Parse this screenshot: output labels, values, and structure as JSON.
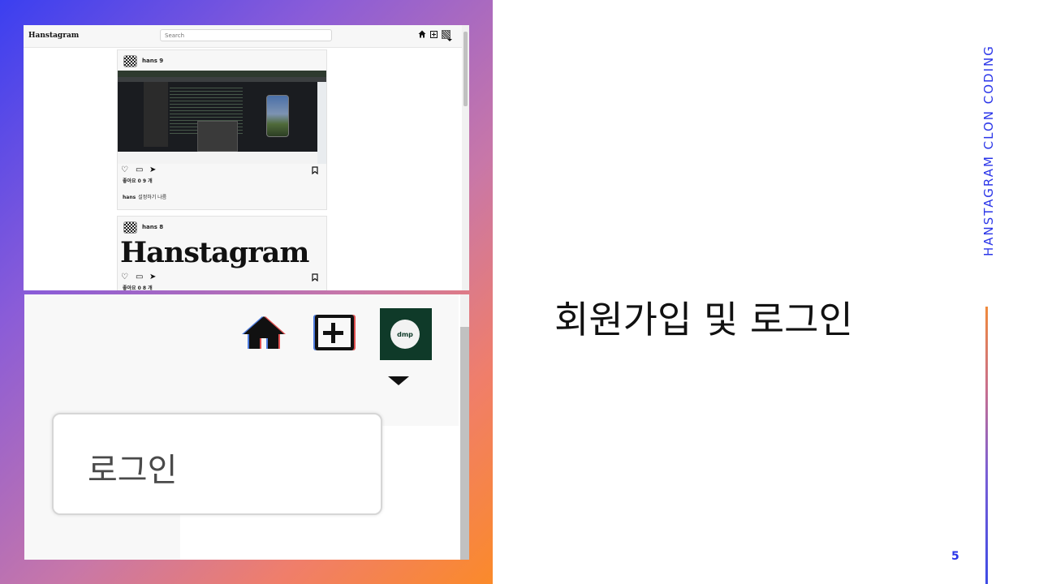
{
  "slide": {
    "title": "회원가입 및 로그인",
    "side_label": "HANSTAGRAM  CLON  CODING",
    "page_number": "5",
    "accent_color": "#2a35e8"
  },
  "top_screenshot": {
    "brand": "Hanstagram",
    "search_placeholder": "Search",
    "nav_icons": [
      "home-icon",
      "add-post-icon",
      "profile-avatar-icon"
    ],
    "posts": [
      {
        "user": "hans 9",
        "likes": "좋아요 0 9 개",
        "caption_user": "hans",
        "caption_text": "설정하기 나름",
        "image": "ide-screenshot"
      },
      {
        "user": "hans 8",
        "likes": "좋아요 0 8 개",
        "image_text": "Hanstagram"
      }
    ]
  },
  "bottom_screenshot": {
    "nav_icons": [
      "home-icon",
      "add-post-icon",
      "profile-avatar-icon"
    ],
    "avatar_text": "dmp",
    "dropdown": {
      "items": [
        "로그인"
      ]
    }
  }
}
